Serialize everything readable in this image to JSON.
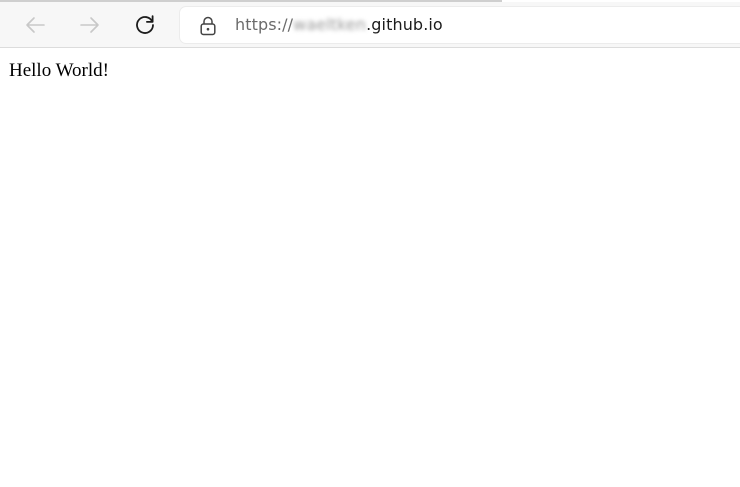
{
  "browser": {
    "toolbar": {
      "back_icon": "arrow-left-icon",
      "forward_icon": "arrow-right-icon",
      "reload_icon": "reload-icon",
      "lock_icon": "lock-icon"
    },
    "address_bar": {
      "scheme": "https://",
      "blurred_part": "waeltken",
      "domain": ".github.io"
    }
  },
  "page": {
    "body_text": "Hello World!"
  },
  "colors": {
    "toolbar_bg": "#f7f7f7",
    "disabled_icon": "#c8c8c8",
    "active_icon": "#1c1c1c",
    "page_bg": "#ffffff",
    "text": "#000000"
  }
}
